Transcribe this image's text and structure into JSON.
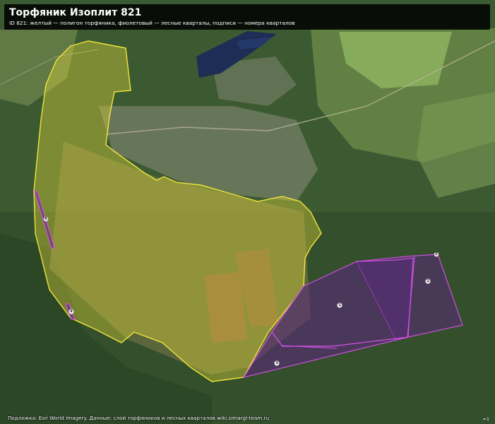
{
  "header": {
    "title": "Торфяник Изоплит 821",
    "subtitle": "ID 821: желтый — полигон торфяника, фиолетовый — лесные кварталы, подписи — номера кварталов"
  },
  "footer": {
    "attribution": "Подложка: Esri World Imagery. Данные: слой торфяников и лесных кварталов wiki.simargl-team.ru",
    "scale_note": "≈1"
  },
  "layers": {
    "peatland": {
      "color": "#e8dc3a",
      "fill_opacity": 0.38
    },
    "forest_quarters": {
      "color": "#c44bd6",
      "fill_opacity": 0.55
    }
  },
  "quarter_labels": [
    "1",
    "2",
    "3",
    "4",
    "5",
    "6"
  ],
  "colors": {
    "forest": "#3c5a32",
    "field": "#7d9a52",
    "water": "#1d2d55",
    "settlement": "#8a8c7a",
    "bog": "#7e7a4c",
    "cutover": "#8b5c40"
  }
}
